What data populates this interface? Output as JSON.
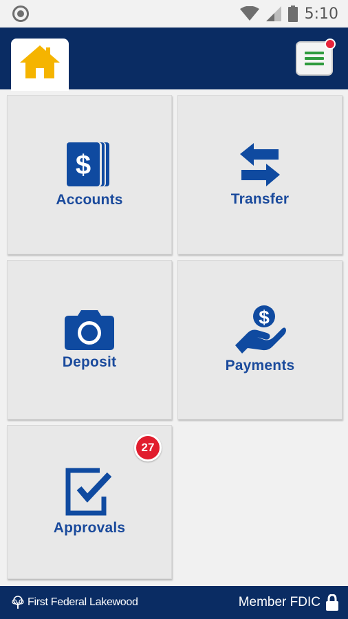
{
  "status_bar": {
    "time": "5:10"
  },
  "header": {
    "home_icon": "home-icon",
    "menu_icon": "menu-icon",
    "colors": {
      "header_bg": "#0a2c63",
      "home_icon": "#f5b400",
      "menu_lines": "#2e9b3d",
      "notification": "#e8233a"
    }
  },
  "tiles": [
    {
      "label": "Accounts",
      "icon": "dollar-cards-icon"
    },
    {
      "label": "Transfer",
      "icon": "transfer-arrows-icon"
    },
    {
      "label": "Deposit",
      "icon": "camera-icon"
    },
    {
      "label": "Payments",
      "icon": "hand-coin-icon"
    },
    {
      "label": "Approvals",
      "icon": "checkbox-icon",
      "badge": "27"
    }
  ],
  "footer": {
    "brand": "First Federal Lakewood",
    "member": "Member FDIC",
    "lock_icon": "lock-icon"
  },
  "colors": {
    "tile_label": "#1a4a9c",
    "tile_bg": "#e8e8e8",
    "badge": "#e11d2e"
  }
}
